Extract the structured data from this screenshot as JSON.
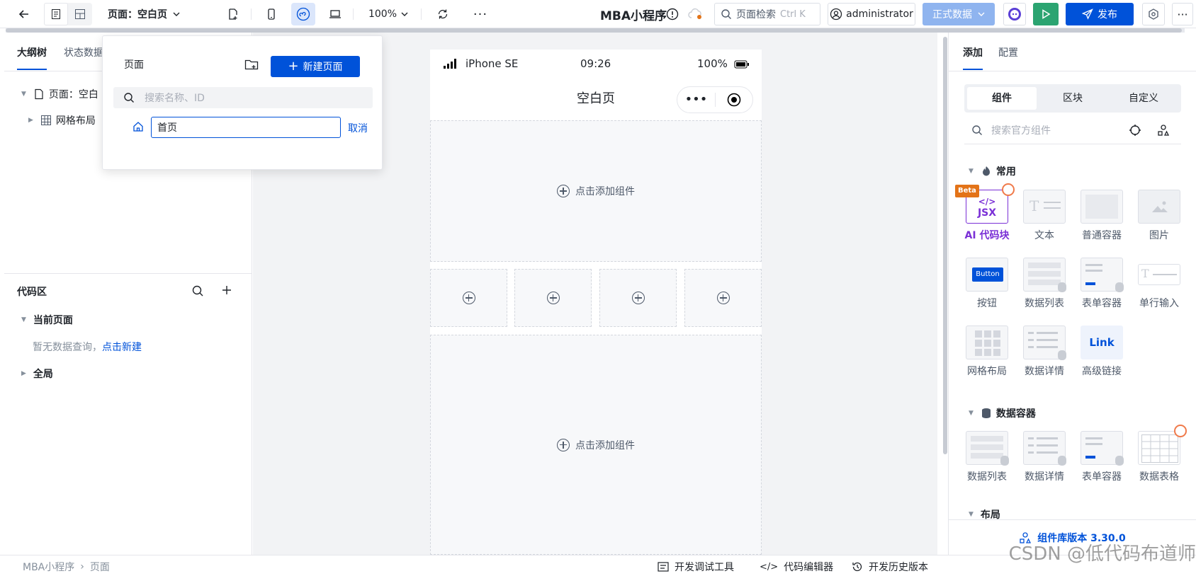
{
  "topbar": {
    "page_label": "页面：空白页",
    "zoom": "100%",
    "app_name": "MBA小程序",
    "search_placeholder": "页面检索",
    "search_shortcut": "Ctrl K",
    "user": "administrator",
    "env": "正式数据",
    "publish": "发布"
  },
  "left": {
    "tabs": [
      "大纲树",
      "状态数据"
    ],
    "tree": [
      {
        "label": "页面：空白"
      },
      {
        "label": "网格布局"
      }
    ],
    "code_area": {
      "title": "代码区",
      "current_page": "当前页面",
      "empty_text": "暂无数据查询，",
      "create_link": "点击新建",
      "global": "全局"
    }
  },
  "popup": {
    "title": "页面",
    "new_page": "新建页面",
    "search_placeholder": "搜索名称、ID",
    "input_value": "首页",
    "cancel": "取消"
  },
  "phone": {
    "carrier": "iPhone SE",
    "time": "09:26",
    "battery": "100%",
    "title": "空白页",
    "add_component": "点击添加组件"
  },
  "right": {
    "tabs": [
      "添加",
      "配置"
    ],
    "segments": [
      "组件",
      "区块",
      "自定义"
    ],
    "search_placeholder": "搜索官方组件",
    "group_common": "常用",
    "group_data": "数据容器",
    "group_layout": "布局",
    "beta": "Beta",
    "jsx": "JSX",
    "common": [
      "AI 代码块",
      "文本",
      "普通容器",
      "图片",
      "按钮",
      "数据列表",
      "表单容器",
      "单行输入",
      "网格布局",
      "数据详情",
      "高级链接"
    ],
    "data": [
      "数据列表",
      "数据详情",
      "表单容器",
      "数据表格"
    ],
    "button_thumb": "Button",
    "link_thumb": "Link",
    "version": "组件库版本 3.30.0"
  },
  "bottom": {
    "breadcrumb": [
      "MBA小程序",
      "页面"
    ],
    "dev_tools": "开发调试工具",
    "code_editor": "代码编辑器",
    "history": "开发历史版本"
  },
  "watermark": "CSDN @低代码布道师",
  "colors": {
    "primary": "#0052d9",
    "success": "#2ba471",
    "purple": "#7a2fd6"
  }
}
